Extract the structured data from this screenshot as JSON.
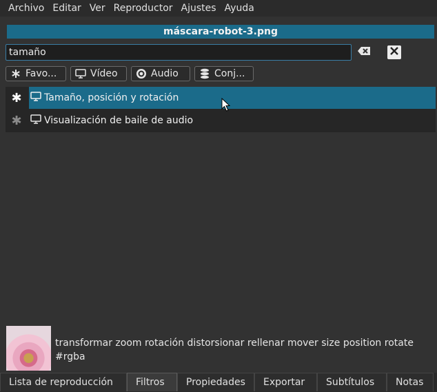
{
  "menubar": {
    "items": [
      "Archivo",
      "Editar",
      "Ver",
      "Reproductor",
      "Ajustes",
      "Ayuda"
    ]
  },
  "file_title": "máscara-robot-3.png",
  "search": {
    "value": "tamaño",
    "clear_icon": "backspace-icon",
    "close_icon": "close-icon"
  },
  "filter_buttons": [
    {
      "label": "Favo...",
      "icon": "asterisk-icon"
    },
    {
      "label": "Vídeo",
      "icon": "monitor-icon"
    },
    {
      "label": "Audio",
      "icon": "disc-icon"
    },
    {
      "label": "Conj...",
      "icon": "stack-icon"
    }
  ],
  "results": [
    {
      "label": "Tamaño, posición y rotación",
      "favorite": true,
      "selected": true,
      "icon": "monitor-icon"
    },
    {
      "label": "Visualización de baile de audio",
      "favorite": false,
      "selected": false,
      "icon": "monitor-icon"
    }
  ],
  "tags_text": "transformar zoom rotación distorsionar rellenar mover size position rotate #rgba",
  "tabs": [
    {
      "label": "Lista de reproducción",
      "active": false
    },
    {
      "label": "Filtros",
      "active": true
    },
    {
      "label": "Propiedades",
      "active": false
    },
    {
      "label": "Exportar",
      "active": false
    },
    {
      "label": "Subtítulos",
      "active": false
    },
    {
      "label": "Notas",
      "active": false
    }
  ],
  "colors": {
    "accent": "#1b6b8a",
    "background": "#323232"
  }
}
